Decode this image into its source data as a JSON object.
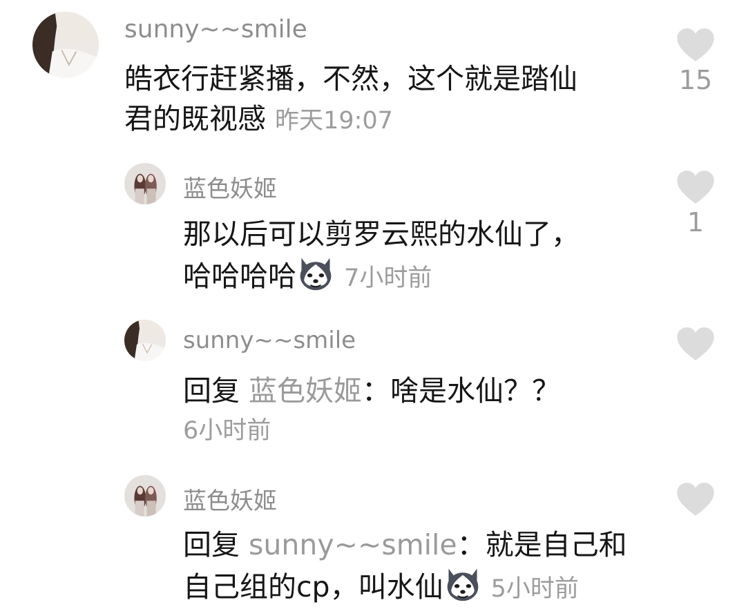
{
  "comments": [
    {
      "username": "sunny~~smile",
      "text_line1": "皓衣行赶紧播，不然，这个就是踏仙",
      "text_line2": "君的既视感",
      "time": "昨天19:07",
      "likes": "15",
      "avatar_icon": "portrait-woman-avatar"
    },
    {
      "username": "蓝色妖姬",
      "text_line1": "那以后可以剪罗云熙的水仙了，",
      "text_line2": "哈哈哈哈",
      "emoji_icon": "husky-dog-emoji-icon",
      "time": "7小时前",
      "likes": "1",
      "avatar_icon": "two-figures-avatar"
    },
    {
      "username": "sunny~~smile",
      "reply_prefix": "回复",
      "reply_to": "蓝色妖姬",
      "text": "：啥是水仙？？",
      "time": "6小时前",
      "avatar_icon": "portrait-woman-avatar"
    },
    {
      "username": "蓝色妖姬",
      "reply_prefix": "回复",
      "reply_to": "sunny~~smile",
      "text_line1": "：就是自己和",
      "text_line2": "自己组的cp，叫水仙",
      "emoji_icon": "husky-dog-emoji-icon",
      "time": "5小时前",
      "avatar_icon": "two-figures-avatar"
    }
  ],
  "colors": {
    "heart": "#dcdcdc",
    "username": "#8d8d8d",
    "body_text": "#161616",
    "meta_text": "#9c9c9c"
  }
}
